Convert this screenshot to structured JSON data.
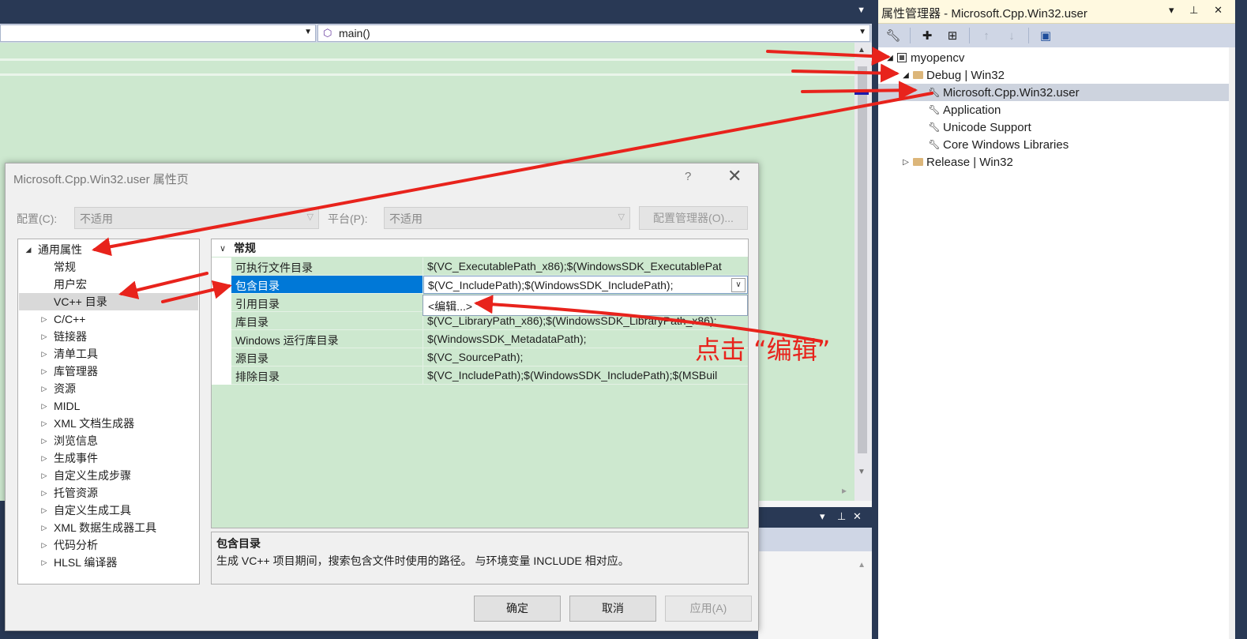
{
  "editor": {
    "nav_right_method": "main()"
  },
  "property_manager": {
    "title": "属性管理器 - Microsoft.Cpp.Win32.user",
    "title_buttons": "▾ ⊥ ✕",
    "toolbar_icons": [
      "wrench-icon",
      "add-sheet-icon",
      "add-new-sheet-icon",
      "move-up-icon",
      "move-down-icon",
      "save-icon"
    ],
    "tree": {
      "project": "myopencv",
      "debug_config": "Debug | Win32",
      "items": [
        "Microsoft.Cpp.Win32.user",
        "Application",
        "Unicode Support",
        "Core Windows Libraries"
      ],
      "release_config": "Release | Win32"
    }
  },
  "dialog": {
    "title": "Microsoft.Cpp.Win32.user 属性页",
    "help": "?",
    "close": "✕",
    "config_label": "配置(C):",
    "config_value": "不适用",
    "platform_label": "平台(P):",
    "platform_value": "不适用",
    "config_manager": "配置管理器(O)...",
    "category_tree": {
      "root": "通用属性",
      "children": [
        "常规",
        "用户宏",
        "VC++ 目录"
      ],
      "groups": [
        "C/C++",
        "链接器",
        "清单工具",
        "库管理器",
        "资源",
        "MIDL",
        "XML 文档生成器",
        "浏览信息",
        "生成事件",
        "自定义生成步骤",
        "托管资源",
        "自定义生成工具",
        "XML 数据生成器工具",
        "代码分析",
        "HLSL 编译器"
      ]
    },
    "grid": {
      "category": "常规",
      "rows": [
        {
          "name": "可执行文件目录",
          "value": "$(VC_ExecutablePath_x86);$(WindowsSDK_ExecutablePat"
        },
        {
          "name": "包含目录",
          "value": "$(VC_IncludePath);$(WindowsSDK_IncludePath);"
        },
        {
          "name": "引用目录",
          "value": ""
        },
        {
          "name": "库目录",
          "value": "$(VC_LibraryPath_x86);$(WindowsSDK_LibraryPath_x86);"
        },
        {
          "name": "Windows 运行库目录",
          "value": "$(WindowsSDK_MetadataPath);"
        },
        {
          "name": "源目录",
          "value": "$(VC_SourcePath);"
        },
        {
          "name": "排除目录",
          "value": "$(VC_IncludePath);$(WindowsSDK_IncludePath);$(MSBuil"
        }
      ],
      "edit_option": "<编辑...>"
    },
    "description": {
      "title": "包含目录",
      "text": "生成 VC++ 项目期间，搜索包含文件时使用的路径。 与环境变量 INCLUDE 相对应。"
    },
    "buttons": {
      "ok": "确定",
      "cancel": "取消",
      "apply": "应用(A)"
    }
  },
  "annotation": {
    "text": "点击 “编辑”",
    "color": "#e8231c"
  }
}
